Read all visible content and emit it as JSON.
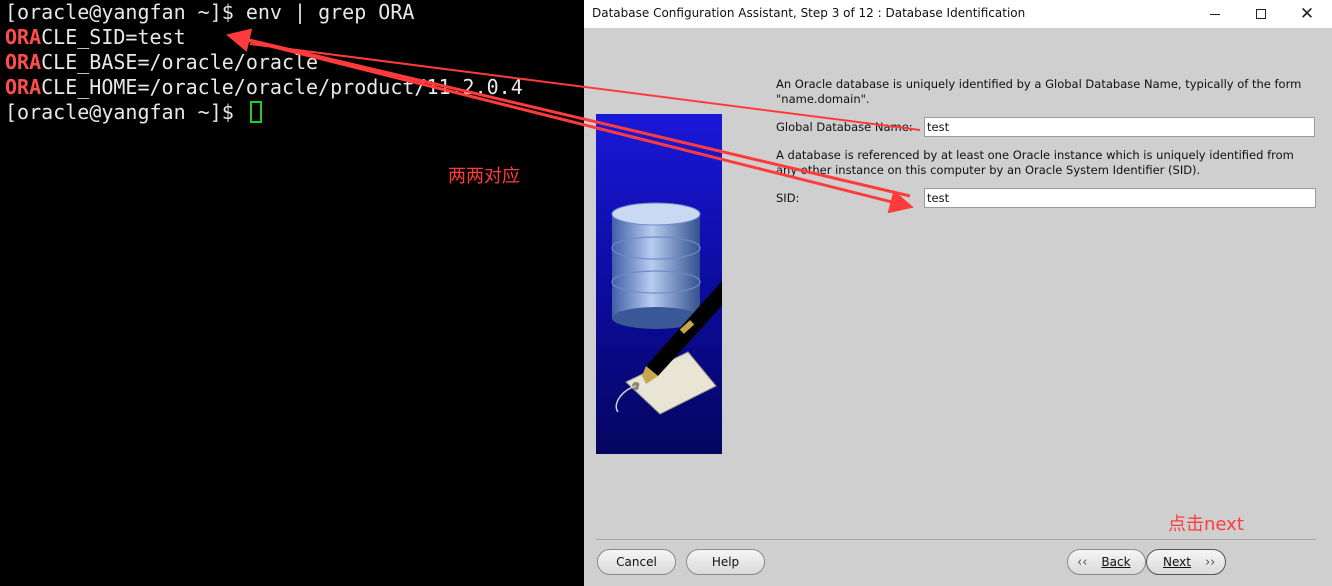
{
  "terminal": {
    "lines": [
      {
        "prefix": "",
        "rest": "[oracle@yangfan ~]$ env | grep ORA"
      },
      {
        "prefix": "ORA",
        "rest": "CLE_SID=test"
      },
      {
        "prefix": "ORA",
        "rest": "CLE_BASE=/oracle/oracle"
      },
      {
        "prefix": "ORA",
        "rest": "CLE_HOME=/oracle/oracle/product/11.2.0.4"
      },
      {
        "prefix": "",
        "rest": "[oracle@yangfan ~]$ "
      }
    ]
  },
  "dialog": {
    "title": "Database Configuration Assistant, Step 3 of 12 : Database Identification",
    "intro_text": "An Oracle database is uniquely identified by a Global Database Name, typically of the form \"name.domain\".",
    "global_db_label": "Global Database Name:",
    "global_db_value": "test",
    "sid_intro_text": "A database is referenced by at least one Oracle instance which is uniquely identified from any other instance on this computer by an Oracle System Identifier (SID).",
    "sid_label": "SID:",
    "sid_value": "test",
    "buttons": {
      "cancel": "Cancel",
      "help": "Help",
      "back": "Back",
      "next": "Next"
    }
  },
  "annotations": {
    "match_note": "两两对应",
    "next_note": "点击next"
  },
  "colors": {
    "annotation_red": "#ff3b3b",
    "terminal_highlight": "#ff4d4d",
    "cursor_green": "#22cc22",
    "dialog_bg": "#cfcfcf"
  }
}
